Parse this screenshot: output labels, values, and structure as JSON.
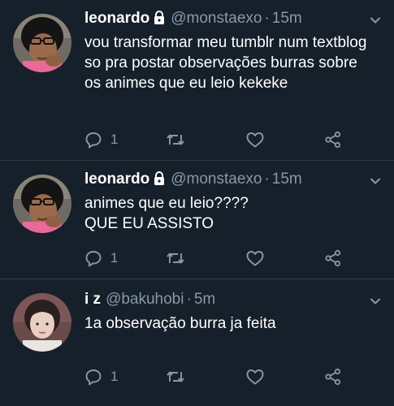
{
  "tweets": [
    {
      "name": "leonardo",
      "handle": "@monstaexo",
      "separator": "·",
      "time": "15m",
      "protected": true,
      "text": "vou transformar meu tumblr num textblog so pra postar observações burras sobre os animes que eu leio kekeke",
      "reply_count": "1"
    },
    {
      "name": "leonardo",
      "handle": "@monstaexo",
      "separator": "·",
      "time": "15m",
      "protected": true,
      "text_lines": [
        "animes que eu leio????",
        "QUE EU ASSISTO"
      ],
      "reply_count": "1"
    },
    {
      "name": "i z",
      "handle": "@bakuhobi",
      "separator": "·",
      "time": "5m",
      "protected": false,
      "text": "1a observação burra ja feita",
      "reply_count": "1"
    }
  ],
  "icons": {
    "lock": "lock-icon",
    "caret": "chevron-down-icon",
    "reply": "reply-icon",
    "retweet": "retweet-icon",
    "like": "heart-icon",
    "share": "share-icon"
  },
  "colors": {
    "background": "#15202b",
    "secondary_text": "#8899a6",
    "divider": "#2f3d4c",
    "primary_text": "#ffffff"
  }
}
